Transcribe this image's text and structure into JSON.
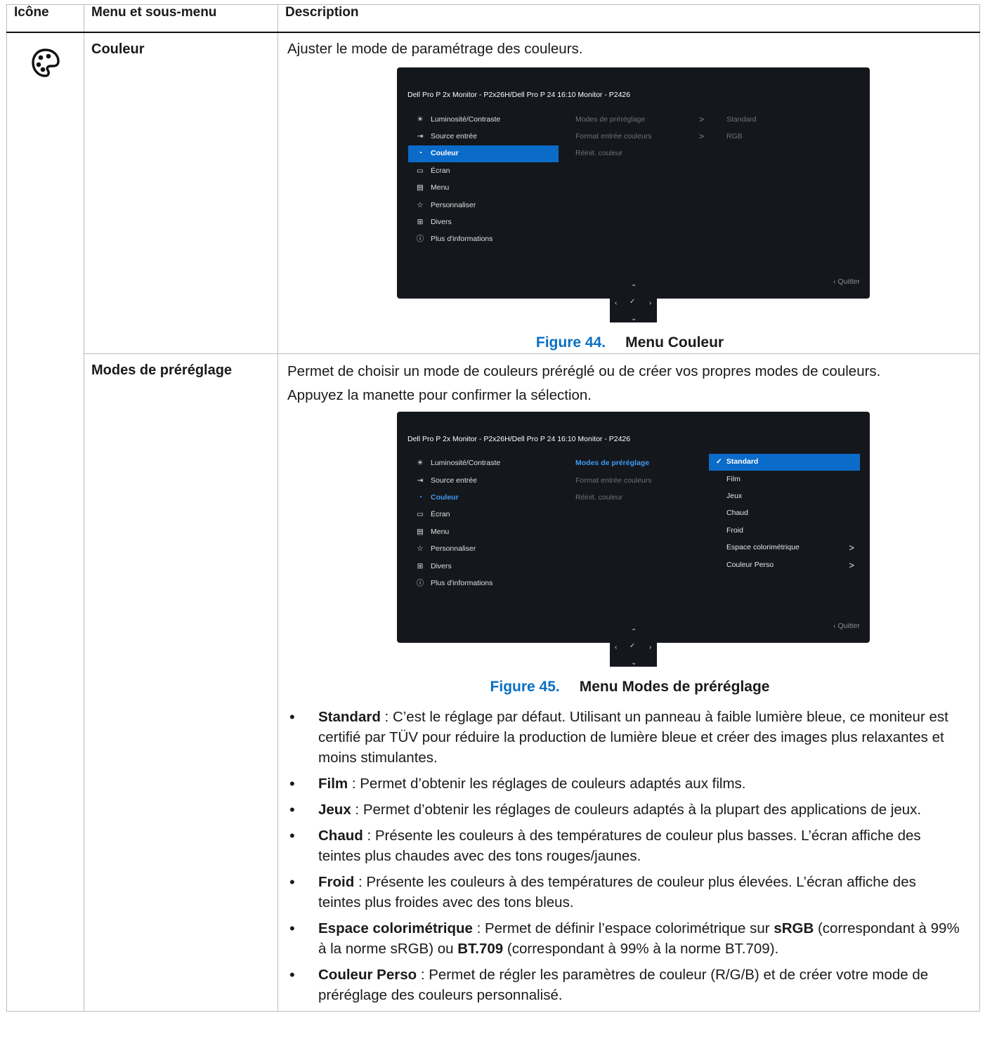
{
  "headers": {
    "icon": "Icône",
    "menu": "Menu et sous-menu",
    "desc": "Description"
  },
  "row1": {
    "menu": "Couleur",
    "desc": "Ajuster le mode de paramétrage des couleurs.",
    "figure_num": "Figure 44.",
    "figure_title": "Menu Couleur"
  },
  "row2": {
    "menu": "Modes de préréglage",
    "desc1": "Permet de choisir un mode de couleurs préréglé ou de créer vos propres modes de couleurs.",
    "desc2": "Appuyez la manette pour confirmer la sélection.",
    "figure_num": "Figure 45.",
    "figure_title": "Menu Modes de préréglage"
  },
  "osd": {
    "title": "Dell Pro P 2x Monitor - P2x26H/Dell Pro P 24 16:10 Monitor - P2426",
    "menu_items": [
      "Luminosité/Contraste",
      "Source entrée",
      "Couleur",
      "Écran",
      "Menu",
      "Personnaliser",
      "Divers",
      "Plus d'informations"
    ],
    "sub_items": [
      "Modes de préréglage",
      "Format entrée couleurs",
      "Réinit. couleur"
    ],
    "values": [
      "Standard",
      "RGB"
    ],
    "presets": [
      "Standard",
      "Film",
      "Jeux",
      "Chaud",
      "Froid",
      "Espace colorimétrique",
      "Couleur Perso"
    ],
    "quit": "Quitter",
    "arrow": ">",
    "check": "✓"
  },
  "bullets": [
    {
      "term": "Standard",
      "text": " : C’est le réglage par défaut. Utilisant un panneau à faible lumière bleue, ce moniteur est certifié par TÜV pour réduire la production de lumière bleue et créer des images plus relaxantes et moins stimulantes."
    },
    {
      "term": "Film",
      "text": " : Permet d’obtenir les réglages de couleurs adaptés aux films."
    },
    {
      "term": "Jeux",
      "text": " : Permet d’obtenir les réglages de couleurs adaptés à la plupart des applications de jeux."
    },
    {
      "term": "Chaud",
      "text": " : Présente les couleurs à des températures de couleur plus basses. L’écran affiche des teintes plus chaudes avec des tons rouges/jaunes."
    },
    {
      "term": "Froid",
      "text": " : Présente les couleurs à des températures de couleur plus élevées. L’écran affiche des teintes plus froides avec des tons bleus."
    },
    {
      "term": "Espace colorimétrique",
      "text": " : Permet de définir l’espace colorimétrique sur ",
      "b2": "sRGB",
      "text2": " (correspondant à 99% à la norme sRGB) ou ",
      "b3": "BT.709",
      "text3": " (correspondant à 99% à la norme BT.709)."
    },
    {
      "term": "Couleur Perso",
      "text": " : Permet de régler les paramètres de couleur (R/G/B) et de créer votre mode de préréglage des couleurs personnalisé."
    }
  ],
  "colors": {
    "accent": "#0a6fc2",
    "osd_bg": "#14171c",
    "osd_select": "#0b6bc9"
  }
}
